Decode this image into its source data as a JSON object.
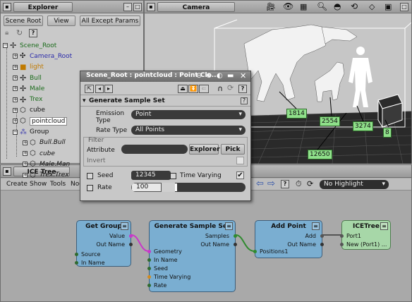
{
  "explorer": {
    "title": "Explorer",
    "scope": "Scene Root",
    "view": "View",
    "filter": "All Except Params",
    "items": [
      {
        "label": "Scene_Root",
        "color": "#1a6b1a"
      },
      {
        "label": "Camera_Root",
        "color": "#2b2baa"
      },
      {
        "label": "light",
        "color": "#c07a00"
      },
      {
        "label": "Bull",
        "color": "#1a6b1a"
      },
      {
        "label": "Male",
        "color": "#1a6b1a"
      },
      {
        "label": "Trex",
        "color": "#1a6b1a"
      },
      {
        "label": "cube",
        "color": "#111111"
      },
      {
        "label": "pointcloud",
        "color": "#111111"
      },
      {
        "label": "Group",
        "color": "#111111"
      },
      {
        "label": "Bull.Bull",
        "color": "#111111"
      },
      {
        "label": "cube",
        "color": "#111111"
      },
      {
        "label": "Male.Man",
        "color": "#111111"
      },
      {
        "label": "Trex.Trex",
        "color": "#111111"
      }
    ]
  },
  "viewport": {
    "title": "Camera",
    "point_labels": [
      "1814",
      "2554",
      "3274",
      "8",
      "12650"
    ]
  },
  "dialog": {
    "title": "Scene_Root : pointcloud : Point Clo...",
    "section": "Generate Sample Set",
    "emission_type_label": "Emission\nType",
    "emission_type_value": "Point",
    "rate_type_label": "Rate Type",
    "rate_type_value": "All Points",
    "filter_label": "Filter",
    "attribute_label": "Attribute",
    "explorer_button": "Explorer",
    "pick_button": "Pick",
    "invert_label": "Invert",
    "seed_label": "Seed",
    "seed_value": "12345",
    "time_varying_label": "Time Varying",
    "rate_label": "Rate",
    "rate_value": "100",
    "rate_fraction": 0.16
  },
  "ice_tree": {
    "title": "ICE Tree",
    "menu": [
      "Create",
      "Show",
      "Tools",
      "Nod"
    ],
    "highlight": "No Highlight",
    "nodes": {
      "get_group": {
        "title": "Get Group",
        "out": [
          "Value",
          "Out Name"
        ],
        "in": [
          "Source",
          "In Name"
        ]
      },
      "generate": {
        "title": "Generate Sample Set",
        "out": [
          "Samples",
          "Out Name"
        ],
        "in": [
          "Geometry",
          "In Name",
          "Seed",
          "Time Varying",
          "Rate"
        ]
      },
      "add_point": {
        "title": "Add Point",
        "out": [
          "Add",
          "Out Name"
        ],
        "in": [
          "Positions1"
        ]
      },
      "ice_tree_node": {
        "title": "ICETree",
        "in": [
          "Port1",
          "New (Port1) ..."
        ]
      }
    }
  }
}
